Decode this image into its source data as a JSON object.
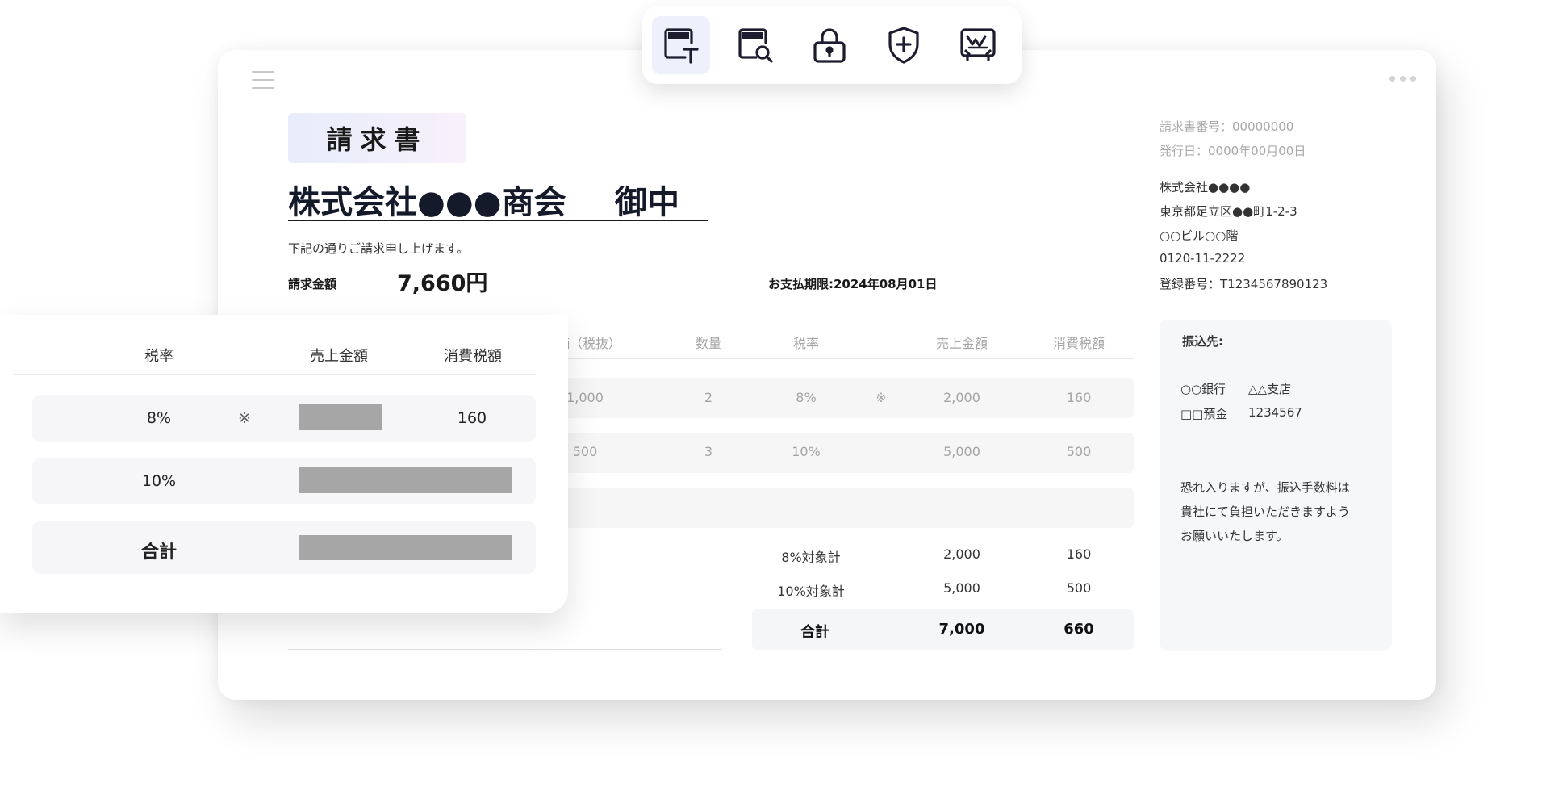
{
  "toolbar": {
    "tools": [
      {
        "icon": "text-field-icon",
        "active": true
      },
      {
        "icon": "document-search-icon",
        "active": false
      },
      {
        "icon": "lock-icon",
        "active": false
      },
      {
        "icon": "shield-plus-icon",
        "active": false
      },
      {
        "icon": "signature-icon",
        "active": false
      }
    ]
  },
  "invoice": {
    "title": "請求書",
    "client": "株式会社●●●商会",
    "honorific": "御中",
    "intro": "下記の通りご請求申し上げます。",
    "amount_label": "請求金額",
    "amount_value": "7,660円",
    "due_date": "お支払期限:2024年08月01日",
    "meta": {
      "number": "請求書番号：00000000",
      "issue_date": "発行日：0000年00月00日",
      "company": "株式会社●●●●",
      "address1": "東京都足立区●●町1-2-3",
      "address2": "○○ビル○○階",
      "phone": "0120-11-2222",
      "registration": "登録番号：T1234567890123"
    },
    "table": {
      "headers": [
        "価（税抜）",
        "数量",
        "税率",
        "売上金額",
        "消費税額"
      ],
      "rows": [
        {
          "price": "1,000",
          "qty": "2",
          "rate": "8%",
          "mark": "※",
          "sales": "2,000",
          "tax": "160"
        },
        {
          "price": "500",
          "qty": "3",
          "rate": "10%",
          "mark": "",
          "sales": "5,000",
          "tax": "500"
        }
      ],
      "summary": [
        {
          "label": "8%対象計",
          "sales": "2,000",
          "tax": "160"
        },
        {
          "label": "10%対象計",
          "sales": "5,000",
          "tax": "500"
        }
      ],
      "total": {
        "label": "合計",
        "sales": "7,000",
        "tax": "660"
      }
    },
    "bank": {
      "heading": "振込先:",
      "bank": "○○銀行",
      "branch": "△△支店",
      "account_type": "□□預金",
      "account_no": "1234567",
      "note1": "恐れ入りますが、振込手数料は",
      "note2": "貴社にて負担いただきますよう",
      "note3": "お願いいたします。"
    }
  },
  "tax_card": {
    "headers": [
      "税率",
      "売上金額",
      "消費税額"
    ],
    "rows": [
      {
        "rate": "8%",
        "mark": "※",
        "tax": "160"
      },
      {
        "rate": "10%",
        "mark": "",
        "tax": ""
      }
    ],
    "total_label": "合計"
  }
}
